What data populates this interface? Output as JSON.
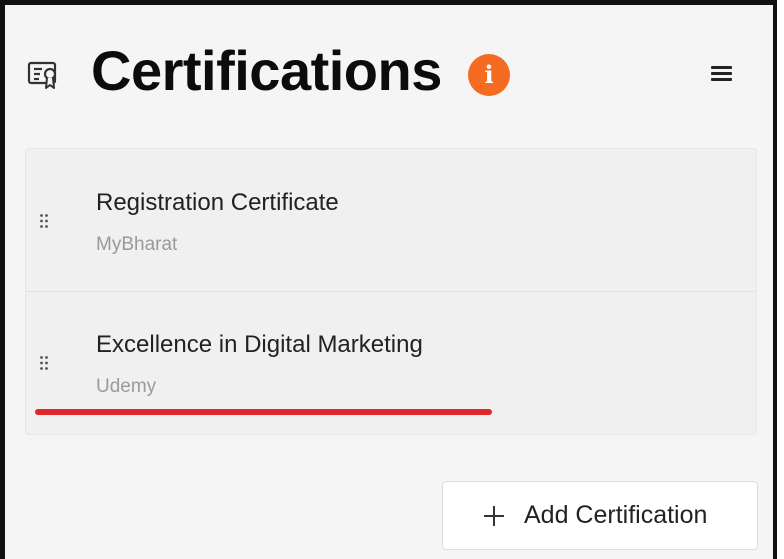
{
  "header": {
    "title": "Certifications",
    "title_icon": "certificate-icon",
    "info_icon": "info-icon",
    "info_glyph": "i",
    "info_color": "#f46b21",
    "menu_icon": "hamburger-menu-icon"
  },
  "certifications": [
    {
      "title": "Registration Certificate",
      "issuer": "MyBharat"
    },
    {
      "title": "Excellence in Digital Marketing",
      "issuer": "Udemy"
    }
  ],
  "drag_handle_icon": "drag-handle-icon",
  "add_button": {
    "icon": "plus-icon",
    "label": "Add Certification"
  },
  "highlight_color": "#e0262b"
}
